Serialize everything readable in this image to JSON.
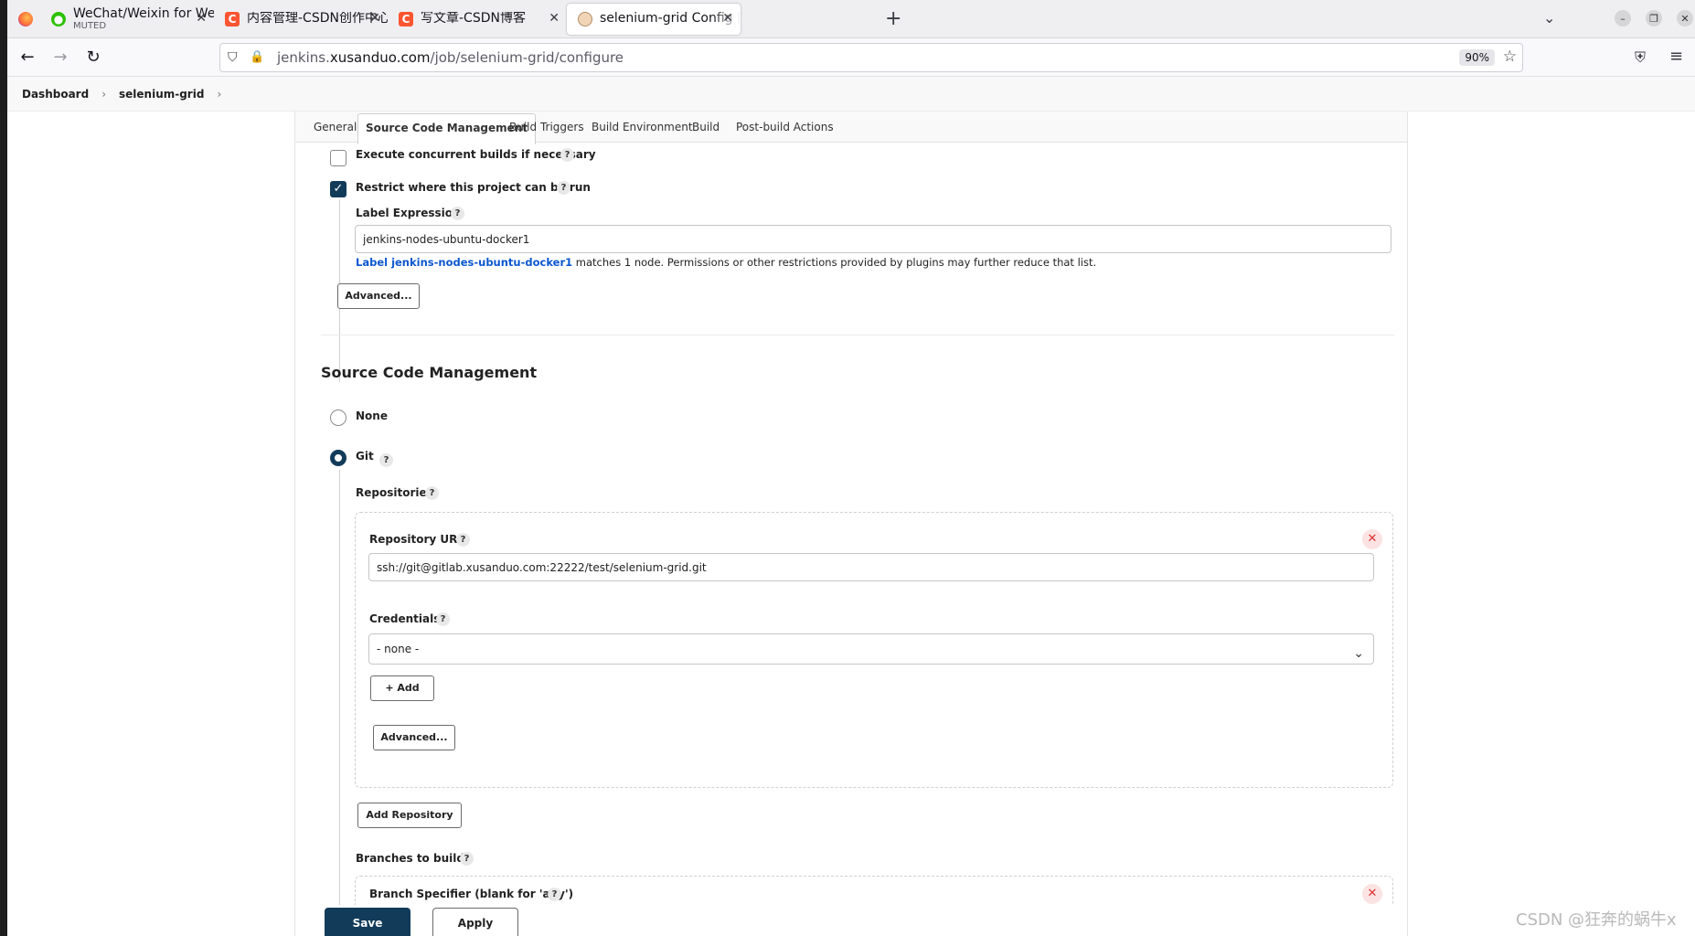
{
  "browser": {
    "tabs": [
      {
        "title": "WeChat/Weixin for Web",
        "subtitle": "MUTED",
        "icon": "wechat-icon"
      },
      {
        "title": "内容管理-CSDN创作中心",
        "icon": "csdn-icon"
      },
      {
        "title": "写文章-CSDN博客",
        "icon": "csdn-icon"
      },
      {
        "title": "selenium-grid Config [Jenkins]",
        "icon": "jenkins-icon"
      }
    ],
    "url_prefix": "jenkins.",
    "url_domain": "xusanduo.com",
    "url_path": "/job/selenium-grid/configure",
    "zoom": "90%"
  },
  "breadcrumb": {
    "items": [
      "Dashboard",
      "selenium-grid"
    ]
  },
  "config_tabs": [
    "General",
    "Source Code Management",
    "Build Triggers",
    "Build Environment",
    "Build",
    "Post-build Actions"
  ],
  "general": {
    "concurrent_label": "Execute concurrent builds if necessary",
    "concurrent_checked": false,
    "restrict_label": "Restrict where this project can be run",
    "restrict_checked": true,
    "label_expression_label": "Label Expression",
    "label_expression_value": "jenkins-nodes-ubuntu-docker1",
    "label_match_link": "Label jenkins-nodes-ubuntu-docker1",
    "label_match_text": " matches 1 node. Permissions or other restrictions provided by plugins may further reduce that list.",
    "advanced_button": "Advanced..."
  },
  "scm": {
    "heading": "Source Code Management",
    "options": [
      {
        "label": "None",
        "selected": false
      },
      {
        "label": "Git",
        "selected": true
      }
    ],
    "repositories_label": "Repositories",
    "repository_url_label": "Repository URL",
    "repository_url_value": "ssh://git@gitlab.xusanduo.com:22222/test/selenium-grid.git",
    "credentials_label": "Credentials",
    "credentials_value": "- none -",
    "add_button": "Add",
    "advanced_button": "Advanced...",
    "add_repository_button": "Add Repository",
    "branches_label": "Branches to build",
    "branch_specifier_label": "Branch Specifier (blank for 'any')"
  },
  "actions": {
    "save": "Save",
    "apply": "Apply"
  },
  "watermark": "CSDN @狂奔的蜗牛x"
}
